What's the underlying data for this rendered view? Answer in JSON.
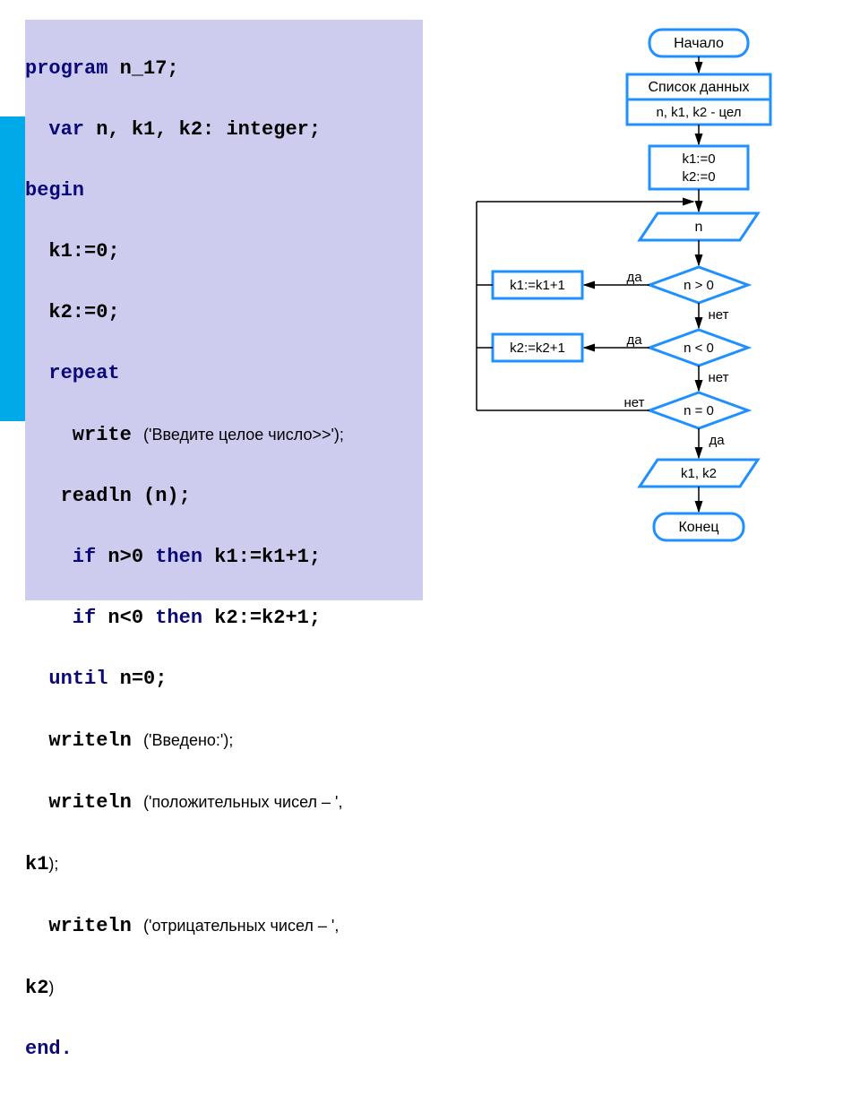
{
  "code": {
    "l1a": "program",
    "l1b": " n_17;",
    "l2a": "  var",
    "l2b": " n, k1, k2: integer;",
    "l3": "begin",
    "l4": "  k1:=0;",
    "l5": "  k2:=0;",
    "l6": "  repeat",
    "l7a": "    write ",
    "l7b": "('Введите целое число>>');",
    "l8": "   readln (n);",
    "l9a": "    if",
    "l9b": " n>0 ",
    "l9c": "then",
    "l9d": " k1:=k1+1;",
    "l10a": "    if",
    "l10b": " n<0 ",
    "l10c": "then",
    "l10d": " k2:=k2+1;",
    "l11a": "  until",
    "l11b": " n=0;",
    "l12a": "  writeln ",
    "l12b": "('Введено:');",
    "l13a": "  writeln ",
    "l13b": "('положительных чисел – ',",
    "l13c": "k1",
    "l13d": ");",
    "l14a": "  writeln ",
    "l14b": "('отрицательных чисел – ',",
    "l14c": "k2",
    "l14d": ")",
    "l15": "end."
  },
  "fc": {
    "start": "Начало",
    "databox1": "Список данных",
    "databox2": "n, k1, k2 - цел",
    "init1": "k1:=0",
    "init2": "k2:=0",
    "in_n": "n",
    "cond1": "n > 0",
    "cond2": "n < 0",
    "cond3": "n = 0",
    "act1": "k1:=k1+1",
    "act2": "k2:=k2+1",
    "out": "k1, k2",
    "end": "Конец",
    "yes": "да",
    "no": "нет"
  }
}
